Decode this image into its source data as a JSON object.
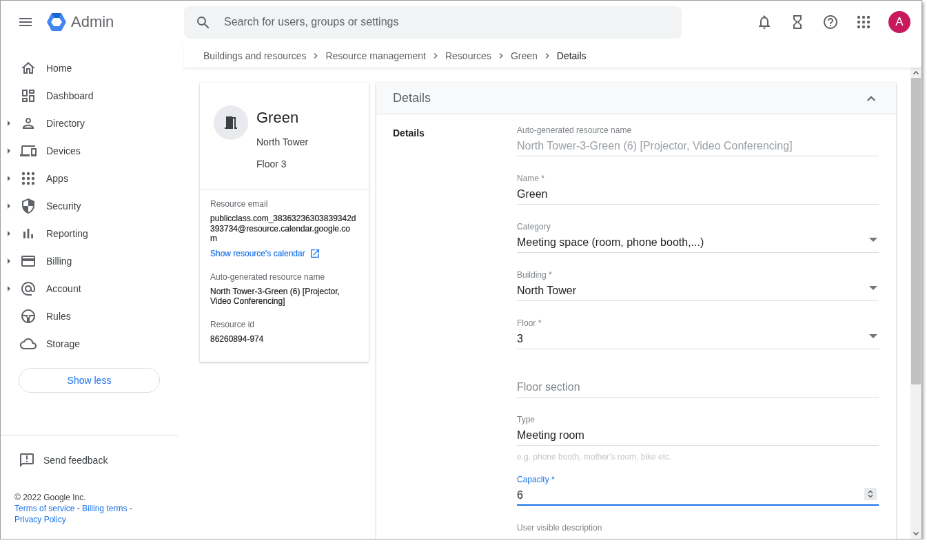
{
  "header": {
    "app_name": "Admin",
    "search": {
      "placeholder": "Search for users, groups or settings"
    },
    "avatar": {
      "initial": "A"
    }
  },
  "breadcrumbs": [
    {
      "label": "Buildings and resources",
      "current": false
    },
    {
      "label": "Resource management",
      "current": false
    },
    {
      "label": "Resources",
      "current": false
    },
    {
      "label": "Green",
      "current": false
    },
    {
      "label": "Details",
      "current": true
    }
  ],
  "sidebar": {
    "items": [
      {
        "label": "Home",
        "expandable": false
      },
      {
        "label": "Dashboard",
        "expandable": false
      },
      {
        "label": "Directory",
        "expandable": true
      },
      {
        "label": "Devices",
        "expandable": true
      },
      {
        "label": "Apps",
        "expandable": true
      },
      {
        "label": "Security",
        "expandable": true
      },
      {
        "label": "Reporting",
        "expandable": true
      },
      {
        "label": "Billing",
        "expandable": true
      },
      {
        "label": "Account",
        "expandable": true
      },
      {
        "label": "Rules",
        "expandable": false
      },
      {
        "label": "Storage",
        "expandable": false
      }
    ],
    "show_less_button": "Show less",
    "feedback": "Send feedback",
    "footer": {
      "copyright": "© 2022 Google Inc.",
      "links": [
        "Terms of service",
        "Billing terms",
        "Privacy Policy"
      ],
      "separator": "-"
    }
  },
  "resource_card": {
    "name": "Green",
    "building": "North Tower",
    "floor": "Floor 3",
    "sections": [
      {
        "label": "Resource email",
        "value": "publicclass.com_38363236303839342d393734@resource.calendar.google.com",
        "link": "Show resource's calendar"
      },
      {
        "label": "Auto-generated resource name",
        "value": "North Tower-3-Green (6) [Projector, Video Conferencing]"
      },
      {
        "label": "Resource id",
        "value": "86260894-974"
      }
    ]
  },
  "details_panel": {
    "title": "Details",
    "expanded": true,
    "section_label": "Details",
    "fields": [
      {
        "kind": "text",
        "label": "Auto-generated resource name",
        "value": "North Tower-3-Green (6) [Projector, Video Conferencing]",
        "disabled": true,
        "focused": false
      },
      {
        "kind": "text",
        "label": "Name *",
        "value": "Green",
        "disabled": false,
        "focused": false
      },
      {
        "kind": "select",
        "label": "Category",
        "value": "Meeting space (room, phone booth,...)",
        "disabled": false,
        "focused": false
      },
      {
        "kind": "select",
        "label": "Building *",
        "value": "North Tower",
        "disabled": false,
        "focused": false
      },
      {
        "kind": "select",
        "label": "Floor *",
        "value": "3",
        "disabled": false,
        "focused": false
      },
      {
        "kind": "text",
        "placeholder": "Floor section",
        "disabled": false,
        "focused": false
      },
      {
        "kind": "text",
        "label": "Type",
        "value": "Meeting room",
        "hint": "e.g. phone booth, mother's room, bike etc.",
        "disabled": false,
        "focused": false
      },
      {
        "kind": "number",
        "label": "Capacity *",
        "value": "6",
        "disabled": false,
        "focused": true
      },
      {
        "kind": "text",
        "label": "User visible description",
        "disabled": false,
        "focused": false
      }
    ]
  }
}
